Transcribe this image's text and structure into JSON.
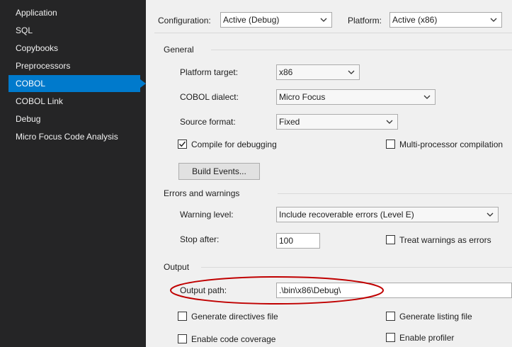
{
  "sidebar": {
    "items": [
      {
        "label": "Application"
      },
      {
        "label": "SQL"
      },
      {
        "label": "Copybooks"
      },
      {
        "label": "Preprocessors"
      },
      {
        "label": "COBOL"
      },
      {
        "label": "COBOL Link"
      },
      {
        "label": "Debug"
      },
      {
        "label": "Micro Focus Code Analysis"
      }
    ],
    "active_index": 4
  },
  "header": {
    "configuration_label": "Configuration:",
    "configuration_value": "Active (Debug)",
    "platform_label": "Platform:",
    "platform_value": "Active (x86)"
  },
  "general": {
    "title": "General",
    "platform_target_label": "Platform target:",
    "platform_target_value": "x86",
    "cobol_dialect_label": "COBOL dialect:",
    "cobol_dialect_value": "Micro Focus",
    "source_format_label": "Source format:",
    "source_format_value": "Fixed",
    "compile_for_debugging_label": "Compile for debugging",
    "compile_for_debugging_checked": true,
    "multiprocessor_label": "Multi-processor compilation",
    "multiprocessor_checked": false,
    "build_events_label": "Build Events..."
  },
  "errors": {
    "title": "Errors and warnings",
    "warning_level_label": "Warning level:",
    "warning_level_value": "Include recoverable errors (Level E)",
    "stop_after_label": "Stop after:",
    "stop_after_value": "100",
    "treat_warnings_label": "Treat warnings as errors",
    "treat_warnings_checked": false
  },
  "output": {
    "title": "Output",
    "output_path_label": "Output path:",
    "output_path_value": ".\\bin\\x86\\Debug\\",
    "generate_directives_label": "Generate directives file",
    "generate_listing_label": "Generate listing file",
    "enable_code_coverage_label": "Enable code coverage",
    "enable_profiler_label": "Enable profiler"
  },
  "colors": {
    "sidebar_bg": "#252526",
    "active_item": "#007acc",
    "panel_bg": "#f0f0f0",
    "highlight_ellipse": "#c00000"
  }
}
